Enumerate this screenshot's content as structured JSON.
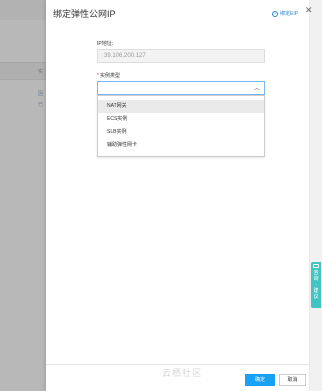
{
  "background": {
    "fragments": [
      "实",
      "因",
      "已"
    ]
  },
  "drawer": {
    "title": "绑定弹性公网IP",
    "help_link": "绑定EIP",
    "ip_label": "IP地址:",
    "ip_value": "39.106.200.127",
    "instance_type_label": "实例类型",
    "required_mark": "*",
    "instance_type_value": "",
    "options": [
      "NAT网关",
      "ECS实例",
      "SLB实例",
      "辅助弹性网卡"
    ],
    "ok_label": "确定",
    "cancel_label": "取消"
  },
  "side_tab": {
    "label": "咨询·建议"
  },
  "watermark": "云栖社区"
}
